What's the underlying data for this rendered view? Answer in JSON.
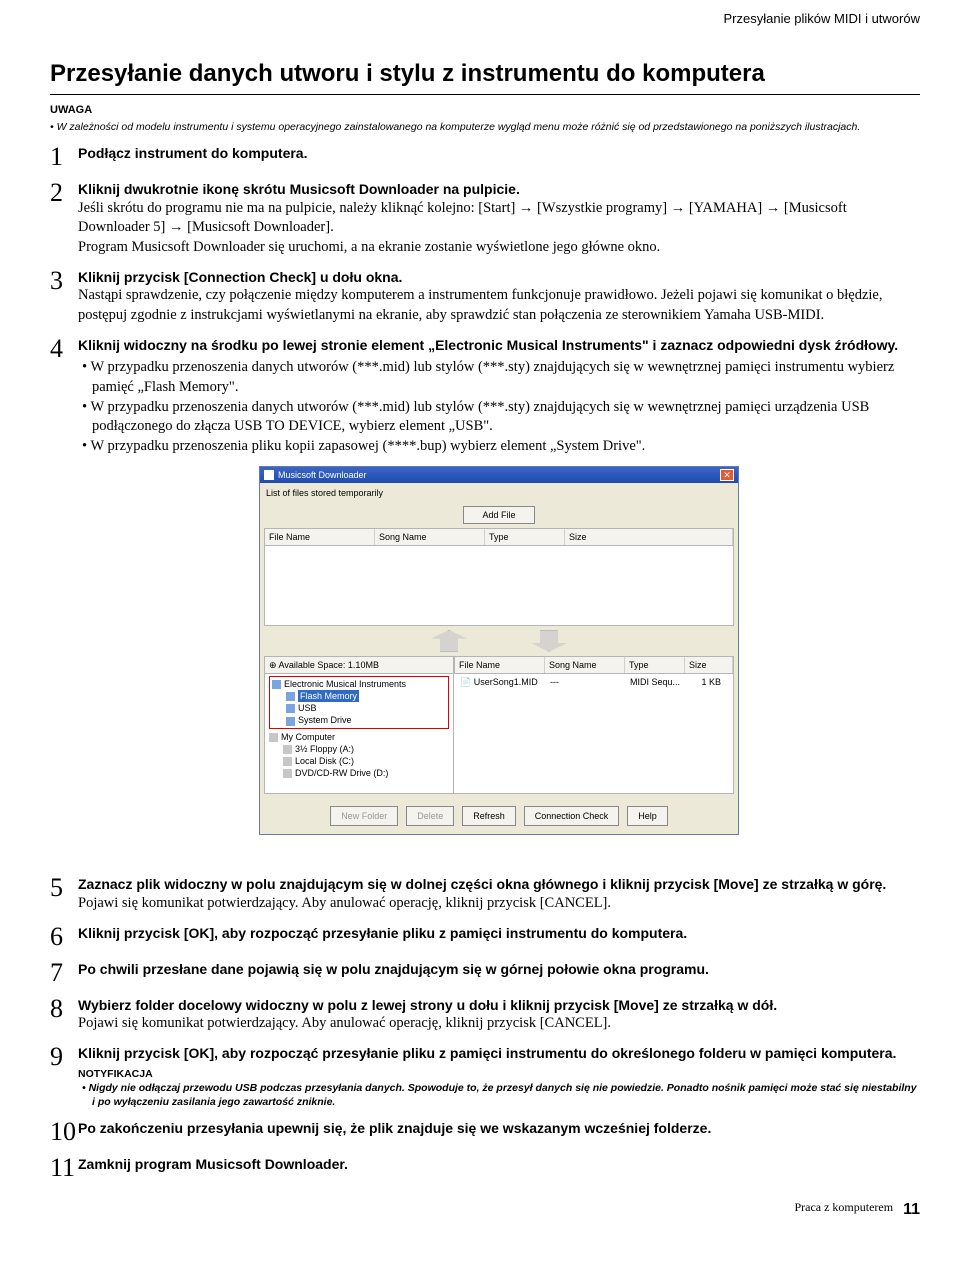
{
  "header": {
    "running_title": "Przesyłanie plików MIDI i utworów"
  },
  "title": "Przesyłanie danych utworu i stylu z instrumentu do komputera",
  "uwaga": {
    "label": "UWAGA",
    "text": "W zależności od modelu instrumentu i systemu operacyjnego zainstalowanego na komputerze wygląd menu może różnić się od przedstawionego na poniższych ilustracjach."
  },
  "steps": [
    {
      "num": "1",
      "head": "Podłącz instrument do komputera."
    },
    {
      "num": "2",
      "head": "Kliknij dwukrotnie ikonę skrótu Musicsoft Downloader na pulpicie.",
      "text": "Jeśli skrótu do programu nie ma na pulpicie, należy kliknąć kolejno: [Start] → [Wszystkie programy] → [YAMAHA] → [Musicsoft Downloader 5] → [Musicsoft Downloader].\nProgram Musicsoft Downloader się uruchomi, a na ekranie zostanie wyświetlone jego główne okno."
    },
    {
      "num": "3",
      "head": "Kliknij przycisk [Connection Check] u dołu okna.",
      "text": "Nastąpi sprawdzenie, czy połączenie między komputerem a instrumentem funkcjonuje prawidłowo. Jeżeli pojawi się komunikat o błędzie, postępuj zgodnie z instrukcjami wyświetlanymi na ekranie, aby sprawdzić stan połączenia ze sterownikiem Yamaha USB-MIDI."
    },
    {
      "num": "4",
      "head": "Kliknij widoczny na środku po lewej stronie element „Electronic Musical Instruments\" i zaznacz odpowiedni dysk źródłowy.",
      "bullets": [
        "• W przypadku przenoszenia danych utworów (***.mid) lub stylów (***.sty) znajdujących się w wewnętrznej pamięci instrumentu wybierz pamięć „Flash Memory\".",
        "• W przypadku przenoszenia danych utworów (***.mid) lub stylów (***.sty) znajdujących się w wewnętrznej pamięci urządzenia USB podłączonego do złącza USB TO DEVICE, wybierz element „USB\".",
        "• W przypadku przenoszenia pliku kopii zapasowej (****.bup) wybierz element „System Drive\"."
      ]
    },
    {
      "num": "5",
      "head": "Zaznacz plik widoczny w polu znajdującym się w dolnej części okna głównego i kliknij przycisk [Move] ze strzałką w górę.",
      "text": "Pojawi się komunikat potwierdzający. Aby anulować operację, kliknij przycisk [CANCEL]."
    },
    {
      "num": "6",
      "head": "Kliknij przycisk [OK], aby rozpocząć przesyłanie pliku z pamięci instrumentu do komputera."
    },
    {
      "num": "7",
      "head": "Po chwili przesłane dane pojawią się w polu znajdującym się w górnej połowie okna programu."
    },
    {
      "num": "8",
      "head": "Wybierz folder docelowy widoczny w polu z lewej strony u dołu i kliknij przycisk [Move] ze strzałką w dół.",
      "text": "Pojawi się komunikat potwierdzający. Aby anulować operację, kliknij przycisk [CANCEL]."
    },
    {
      "num": "9",
      "head": "Kliknij przycisk [OK], aby rozpocząć przesyłanie pliku z pamięci instrumentu do określonego folderu w pamięci komputera.",
      "notif_label": "NOTYFIKACJA",
      "notif_text": "• Nigdy nie odłączaj przewodu USB podczas przesyłania danych. Spowoduje to, że przesył danych się nie powiedzie. Ponadto nośnik pamięci może stać się niestabilny i po wyłączeniu zasilania jego zawartość zniknie."
    },
    {
      "num": "10",
      "head": "Po zakończeniu przesyłania upewnij się, że plik znajduje się we wskazanym wcześniej folderze."
    },
    {
      "num": "11",
      "head": "Zamknij program Musicsoft Downloader."
    }
  ],
  "app": {
    "title": "Musicsoft Downloader",
    "list_label": "List of files stored temporarily",
    "add_file": "Add File",
    "cols": {
      "file": "File Name",
      "song": "Song Name",
      "type": "Type",
      "size": "Size"
    },
    "avail": "Available Space: 1.10MB",
    "tree": {
      "root": "Electronic Musical Instruments",
      "flash": "Flash Memory",
      "usb": "USB",
      "sysdrive": "System Drive",
      "mycomputer": "My Computer",
      "floppy": "3½ Floppy (A:)",
      "local": "Local Disk (C:)",
      "dvd": "DVD/CD-RW Drive (D:)"
    },
    "file_row": {
      "name": "UserSong1.MID",
      "song": "---",
      "type": "MIDI Sequ...",
      "size": "1 KB"
    },
    "buttons": {
      "newfolder": "New Folder",
      "delete": "Delete",
      "refresh": "Refresh",
      "conn": "Connection Check",
      "help": "Help"
    }
  },
  "footer": {
    "label": "Praca z komputerem",
    "page": "11"
  }
}
